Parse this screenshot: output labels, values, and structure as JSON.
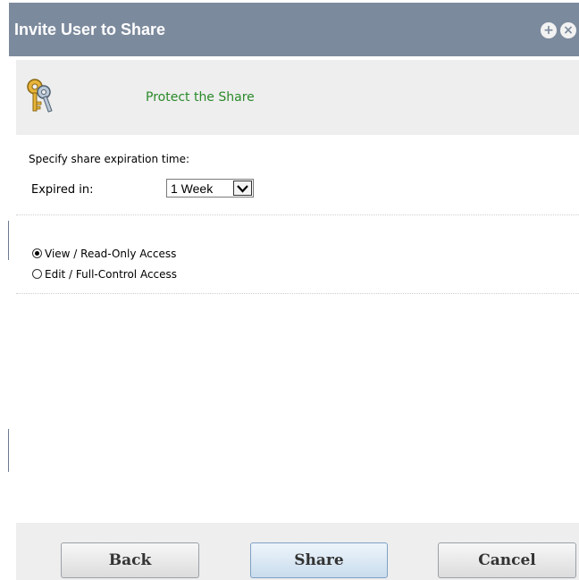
{
  "dialog": {
    "title": "Invite User to Share",
    "titlebar_buttons": [
      "plus-circle-icon",
      "close-circle-icon"
    ]
  },
  "header": {
    "icon": "keys-icon",
    "title": "Protect the Share"
  },
  "expiration": {
    "section_label": "Specify share expiration time:",
    "field_label": "Expired in:",
    "selected": "1 Week"
  },
  "access": {
    "options": [
      {
        "label": "View / Read-Only Access",
        "checked": true
      },
      {
        "label": "Edit / Full-Control Access",
        "checked": false
      }
    ]
  },
  "footer": {
    "back_label": "Back",
    "share_label": "Share",
    "cancel_label": "Cancel"
  },
  "colors": {
    "titlebar": "#7c8a9d",
    "header_title": "#2a8a2a",
    "panel_bg": "#eeeeee"
  }
}
